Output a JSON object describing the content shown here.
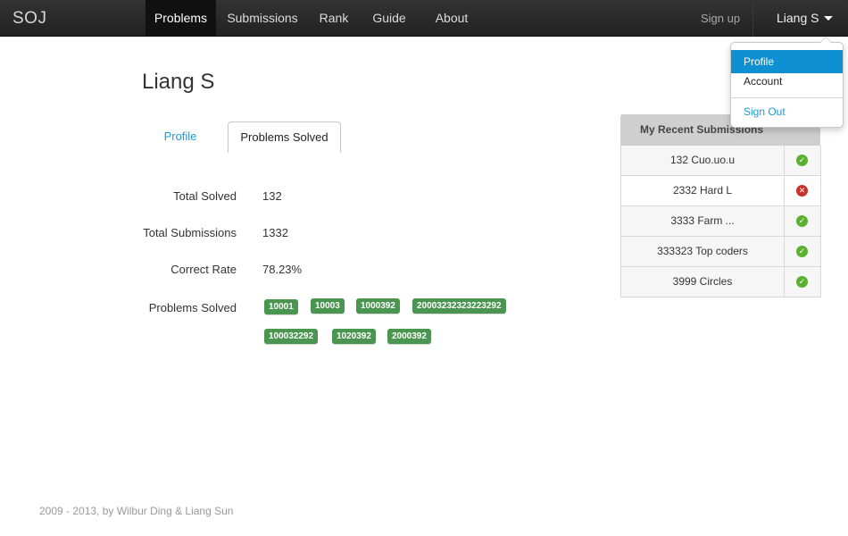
{
  "nav": {
    "brand": "SOJ",
    "items": [
      {
        "label": "Problems",
        "active": true
      },
      {
        "label": "Submissions",
        "active": false
      },
      {
        "label": "Rank",
        "active": false
      },
      {
        "label": "Guide",
        "active": false
      },
      {
        "label": "About",
        "active": false
      }
    ],
    "signup": "Sign up",
    "user": "Liang S"
  },
  "user_menu": {
    "items": [
      {
        "label": "Profile",
        "active": true
      },
      {
        "label": "Account",
        "active": false
      }
    ],
    "signout": "Sign Out"
  },
  "profile": {
    "name": "Liang S",
    "tabs": [
      {
        "label": "Profile",
        "active": false
      },
      {
        "label": "Problems Solved",
        "active": true
      }
    ],
    "stats": [
      {
        "label": "Total Solved",
        "value": "132"
      },
      {
        "label": "Total Submissions",
        "value": "1332"
      },
      {
        "label": "Correct Rate",
        "value": "78.23%"
      }
    ],
    "solved_label": "Problems Solved",
    "solved_problems": [
      "10001",
      "10003",
      "1000392",
      "20003232323223292",
      "100032292",
      "1020392",
      "2000392"
    ]
  },
  "recent": {
    "title": "My Recent Submissions",
    "rows": [
      {
        "label": "132 Cuo.uo.u",
        "status": "accepted"
      },
      {
        "label": "2332 Hard L",
        "status": "rejected"
      },
      {
        "label": "3333 Farm ...",
        "status": "accepted"
      },
      {
        "label": "333323 Top coders",
        "status": "accepted"
      },
      {
        "label": "3999 Circles",
        "status": "accepted"
      }
    ]
  },
  "colors": {
    "badge": "#4a9550",
    "accent": "#0e90d2",
    "ok": "#5cb030",
    "error": "#c8302a"
  },
  "icons": {
    "accepted": "check-circle-icon",
    "rejected": "x-circle-icon",
    "dropdown": "caret-down-icon"
  },
  "footer": "2009 - 2013, by Wilbur Ding & Liang Sun"
}
